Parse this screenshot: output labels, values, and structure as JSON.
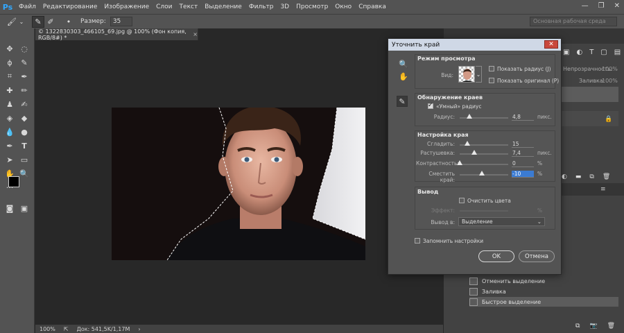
{
  "app": {
    "logo": "Ps"
  },
  "menu": [
    "Файл",
    "Редактирование",
    "Изображение",
    "Слои",
    "Текст",
    "Выделение",
    "Фильтр",
    "3D",
    "Просмотр",
    "Окно",
    "Справка"
  ],
  "window_controls": {
    "minimize": "—",
    "maximize": "❐",
    "close": "✕"
  },
  "options": {
    "size_label": "Размер:",
    "size_value": "35",
    "workspace": "Основная рабочая среда"
  },
  "document": {
    "tab_title": "© 1322830303_466105_69.jpg @ 100% (Фон копия, RGB/8#) *",
    "zoom": "100%",
    "doc_info": "Док: 541,5K/1,17M"
  },
  "right_panel": {
    "opacity_label": "Непрозрачность:",
    "opacity_value": "100%",
    "fill_label": "Заливка:",
    "fill_value": "100%",
    "history": [
      {
        "label": "Отменить выделение"
      },
      {
        "label": "Заливка"
      },
      {
        "label": "Быстрое выделение"
      }
    ]
  },
  "dialog": {
    "title": "Уточнить край",
    "close": "✕",
    "view_mode": {
      "title": "Режим просмотра",
      "view_label": "Вид:",
      "show_radius": "Показать радиус (J)",
      "show_original": "Показать оригинал (P)"
    },
    "edge_detection": {
      "title": "Обнаружение краев",
      "smart_radius": "«Умный» радиус",
      "smart_radius_checked": true,
      "radius_label": "Радиус:",
      "radius_value": "4,8",
      "radius_unit": "пикс.",
      "radius_fraction": 0.2
    },
    "adjust_edge": {
      "title": "Настройка края",
      "rows": [
        {
          "label": "Сгладить:",
          "value": "15",
          "unit": "",
          "fraction": 0.15
        },
        {
          "label": "Растушевка:",
          "value": "7,4",
          "unit": "пикс.",
          "fraction": 0.3
        },
        {
          "label": "Контрастность:",
          "value": "0",
          "unit": "%",
          "fraction": 0.0
        },
        {
          "label": "Сместить край:",
          "value": "-10",
          "unit": "%",
          "fraction": 0.45
        }
      ]
    },
    "output": {
      "title": "Вывод",
      "decontaminate": "Очистить цвета",
      "amount_label": "Эффект:",
      "amount_unit": "%",
      "output_to_label": "Вывод в:",
      "output_to_value": "Выделение"
    },
    "remember": "Запомнить настройки",
    "ok": "OK",
    "cancel": "Отмена"
  },
  "colors": {
    "menubar": "#535353",
    "panel": "#424242",
    "canvas_bg": "#282828",
    "dialog": "#535353",
    "accent": "#3b7bd2",
    "ps_blue": "#31a8ff"
  }
}
